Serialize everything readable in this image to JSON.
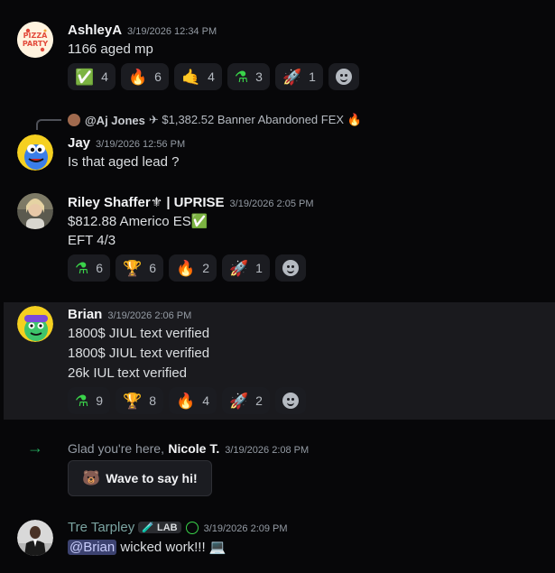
{
  "messages": [
    {
      "username": "AshleyA",
      "timestamp": "3/19/2026 12:34 PM",
      "lines": [
        "1166 aged mp"
      ],
      "reactions": [
        {
          "emoji": "✅",
          "count": "4"
        },
        {
          "emoji": "🔥",
          "count": "6"
        },
        {
          "emoji": "🤙",
          "count": "4"
        },
        {
          "emoji": "⚗",
          "count": "3"
        },
        {
          "emoji": "🚀",
          "count": "1"
        }
      ],
      "avatar_text": "PIZZA PARTY"
    },
    {
      "reply": {
        "name": "@Aj Jones",
        "text": "✈ $1,382.52 Banner Abandoned FEX 🔥"
      },
      "username": "Jay",
      "timestamp": "3/19/2026 12:56 PM",
      "lines": [
        "Is that  aged lead ?"
      ]
    },
    {
      "username": "Riley Shaffer⚜ | UPRISE",
      "timestamp": "3/19/2026 2:05 PM",
      "lines": [
        "$812.88 Americo ES✅",
        "EFT 4/3"
      ],
      "reactions": [
        {
          "emoji": "⚗",
          "count": "6"
        },
        {
          "emoji": "🏆",
          "count": "6"
        },
        {
          "emoji": "🔥",
          "count": "2"
        },
        {
          "emoji": "🚀",
          "count": "1"
        }
      ]
    },
    {
      "username": "Brian",
      "timestamp": "3/19/2026 2:06 PM",
      "lines": [
        "1800$  JIUL text verified",
        "1800$ JIUL text verified",
        "26k IUL text verified"
      ],
      "reactions": [
        {
          "emoji": "⚗",
          "count": "9"
        },
        {
          "emoji": "🏆",
          "count": "8"
        },
        {
          "emoji": "🔥",
          "count": "4"
        },
        {
          "emoji": "🚀",
          "count": "2"
        }
      ]
    },
    {
      "system_text": "Glad you're here,",
      "username": "Nicole T.",
      "timestamp": "3/19/2026 2:08 PM",
      "wave_label": "Wave to say hi!",
      "wave_emoji": "🐻"
    },
    {
      "username": "Tre Tarpley",
      "tag": "LAB",
      "tag_emoji": "🧪",
      "timestamp": "3/19/2026 2:09 PM",
      "mention": "@Brian",
      "text": " wicked work!!! 💻"
    }
  ],
  "colors": {
    "system_arrow": "#23a55a",
    "mention_bg": "#3c4270",
    "tre_name": "#7aa3a0"
  }
}
